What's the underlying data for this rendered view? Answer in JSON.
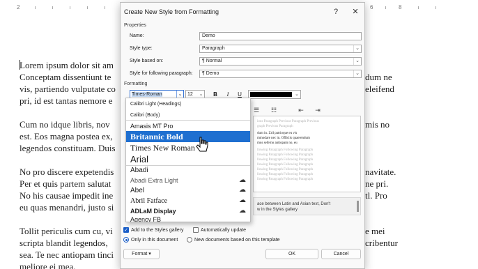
{
  "ruler": {
    "left_marker": "2",
    "mid_number": "6",
    "mid2_number": "8"
  },
  "document": {
    "lines_left": [
      "Lorem ipsum dolor sit am",
      "Conceptam dissentiunt te",
      "vis, partiendo vulputate co",
      "pri, id est tantas nemore e",
      "",
      "Cum no idque libris, nov",
      "est. Eos magna postea ex,",
      "legendos constituam. Duis",
      "",
      "No pro discere expetendis",
      "Per et quis partem salutat",
      "No his causae impedit ine",
      "eu quas menandri, justo si",
      "",
      "Tollit periculis cum cu, vi",
      "scripta blandit legendos,",
      "sea. Te nec antiopam tinci",
      "meliore ei mea."
    ],
    "lines_right": [
      {
        "row": 1,
        "text": "dum ne"
      },
      {
        "row": 2,
        "text": "eleifend"
      },
      {
        "row": 5,
        "text": "mis no"
      },
      {
        "row": 9,
        "text": "navitate."
      },
      {
        "row": 10,
        "text": "ne pri."
      },
      {
        "row": 11,
        "text": "tl. Pro"
      },
      {
        "row": 14,
        "text": "e mei"
      },
      {
        "row": 15,
        "text": "cribentur"
      }
    ]
  },
  "dialog": {
    "title": "Create New Style from Formatting",
    "help": "?",
    "close": "✕",
    "properties_label": "Properties",
    "name_label": "Name:",
    "name_value": "Demo",
    "type_label": "Style type:",
    "type_value": "Paragraph",
    "based_label": "Style based on:",
    "based_value": "¶ Normal",
    "following_label": "Style for following paragraph:",
    "following_value": "¶ Demo",
    "formatting_label": "Formatting",
    "font_value": "Times-Roman",
    "size_value": "12",
    "bold": "B",
    "italic": "I",
    "underline": "U",
    "preview_gray": [
      "ious Paragraph Previous Paragraph Previous",
      "graph Previous Paragraph"
    ],
    "preview_black": [
      "dum in. Zril patrioque eu vis",
      "mmodare nec in. Officiis quaerendum",
      "mus seferno antiopam no, eu"
    ],
    "preview_gray2": [
      "llowing Paragraph Following Paragraph",
      "llowing Paragraph Following Paragraph",
      "llowing Paragraph Following Paragraph",
      "llowing Paragraph Following Paragraph",
      "llowing Paragraph Following Paragraph",
      "llowing Paragraph Following Paragraph",
      "llowing Paragraph Following Paragraph"
    ],
    "description": [
      "ace between Latin and Asian text, Don't",
      "w in the Styles gallery"
    ],
    "add_gallery": "Add to the Styles gallery",
    "auto_update": "Automatically update",
    "only_doc": "Only in this document",
    "new_docs": "New documents based on this template",
    "format_btn": "Format ▾",
    "ok_btn": "OK",
    "cancel_btn": "Cancel"
  },
  "font_list": {
    "theme_header": "Calibri Light (Headings)",
    "theme_body": "Calibri (Body)",
    "recent": [
      "Amasis MT Pro",
      "Britannic Bold",
      "Times New Roman",
      "Arial"
    ],
    "all": [
      "Abadi",
      "Abadi Extra Light",
      "Abel",
      "Abril Fatface",
      "ADLaM Display",
      "Agency FB"
    ],
    "highlighted": "Britannic Bold"
  }
}
